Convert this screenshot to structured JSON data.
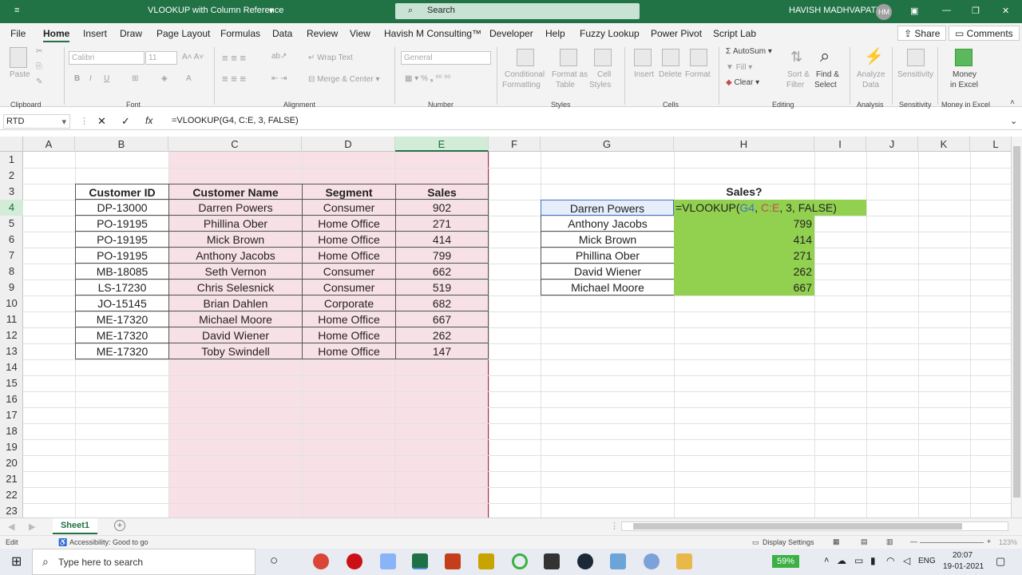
{
  "window": {
    "title": "VLOOKUP with Column Reference",
    "search_placeholder": "Search",
    "user": "HAVISH MADHVAPATY",
    "user_initials": "HM"
  },
  "menu": {
    "tabs": [
      "File",
      "Home",
      "Insert",
      "Draw",
      "Page Layout",
      "Formulas",
      "Data",
      "Review",
      "View",
      "Havish M Consulting™",
      "Developer",
      "Help",
      "Fuzzy Lookup",
      "Power Pivot",
      "Script Lab"
    ],
    "share": "Share",
    "comments": "Comments"
  },
  "ribbon": {
    "clipboard": {
      "paste": "Paste",
      "label": "Clipboard"
    },
    "font": {
      "name": "Calibri",
      "size": "11",
      "label": "Font",
      "bold": "B",
      "italic": "I",
      "underline": "U"
    },
    "alignment": {
      "wrap": "Wrap Text",
      "merge": "Merge & Center",
      "label": "Alignment"
    },
    "number": {
      "format": "General",
      "label": "Number"
    },
    "styles": {
      "conditional": "Conditional",
      "formatting": "Formatting",
      "format_as": "Format as",
      "table": "Table",
      "cell": "Cell",
      "cell_styles": "Styles",
      "label": "Styles"
    },
    "cells": {
      "insert": "Insert",
      "delete": "Delete",
      "format": "Format",
      "label": "Cells"
    },
    "editing": {
      "autosum": "AutoSum",
      "fill": "Fill",
      "clear": "Clear",
      "sort": "Sort &",
      "filter": "Filter",
      "find": "Find &",
      "select": "Select",
      "label": "Editing"
    },
    "analysis": {
      "analyze": "Analyze",
      "data": "Data",
      "label": "Analysis"
    },
    "sensitivity": {
      "btn": "Sensitivity",
      "label": "Sensitivity"
    },
    "money": {
      "money": "Money",
      "in_excel": "in Excel",
      "label": "Money in Excel"
    }
  },
  "formula_bar": {
    "name_box": "RTD",
    "cancel": "✕",
    "enter": "✓",
    "fx": "fx",
    "formula": "=VLOOKUP(G4, C:E, 3, FALSE)"
  },
  "columns": [
    "A",
    "B",
    "C",
    "D",
    "E",
    "F",
    "G",
    "H",
    "I",
    "J",
    "K",
    "L"
  ],
  "rows": [
    "1",
    "2",
    "3",
    "4",
    "5",
    "6",
    "7",
    "8",
    "9",
    "10",
    "11",
    "12",
    "13",
    "14",
    "15",
    "16",
    "17",
    "18",
    "19",
    "20",
    "21",
    "22",
    "23"
  ],
  "table": {
    "headers": [
      "Customer ID",
      "Customer Name",
      "Segment",
      "Sales"
    ],
    "rows": [
      [
        "DP-13000",
        "Darren Powers",
        "Consumer",
        "902"
      ],
      [
        "PO-19195",
        "Phillina Ober",
        "Home Office",
        "271"
      ],
      [
        "PO-19195",
        "Mick Brown",
        "Home Office",
        "414"
      ],
      [
        "PO-19195",
        "Anthony Jacobs",
        "Home Office",
        "799"
      ],
      [
        "MB-18085",
        "Seth Vernon",
        "Consumer",
        "662"
      ],
      [
        "LS-17230",
        "Chris Selesnick",
        "Consumer",
        "519"
      ],
      [
        "JO-15145",
        "Brian Dahlen",
        "Corporate",
        "682"
      ],
      [
        "ME-17320",
        "Michael Moore",
        "Home Office",
        "667"
      ],
      [
        "ME-17320",
        "David Wiener",
        "Home Office",
        "262"
      ],
      [
        "ME-17320",
        "Toby Swindell",
        "Home Office",
        "147"
      ]
    ]
  },
  "lookup": {
    "header": "Sales?",
    "names": [
      "Darren Powers",
      "Anthony Jacobs",
      "Mick Brown",
      "Phillina Ober",
      "David Wiener",
      "Michael Moore"
    ],
    "formula_parts": [
      "=VLOOKUP(",
      "G4",
      ", ",
      "C:E",
      ", 3, FALSE)"
    ],
    "values": [
      "",
      "799",
      "414",
      "271",
      "262",
      "667"
    ]
  },
  "sheet": {
    "tab": "Sheet1",
    "add": "+"
  },
  "status": {
    "mode": "Edit",
    "accessibility": "Accessibility: Good to go",
    "display": "Display Settings",
    "zoom": "123%"
  },
  "taskbar": {
    "search": "Type here to search",
    "battery": "59%",
    "lang": "ENG",
    "time": "20:07",
    "date": "19-01-2021"
  },
  "colors": {
    "green": "#217346",
    "pink": "#f8e1e6",
    "pink_border": "#a52a4a",
    "formula_fill": "#92d050",
    "ref_blue": "#4472c4",
    "ref_red": "#c0504d"
  }
}
